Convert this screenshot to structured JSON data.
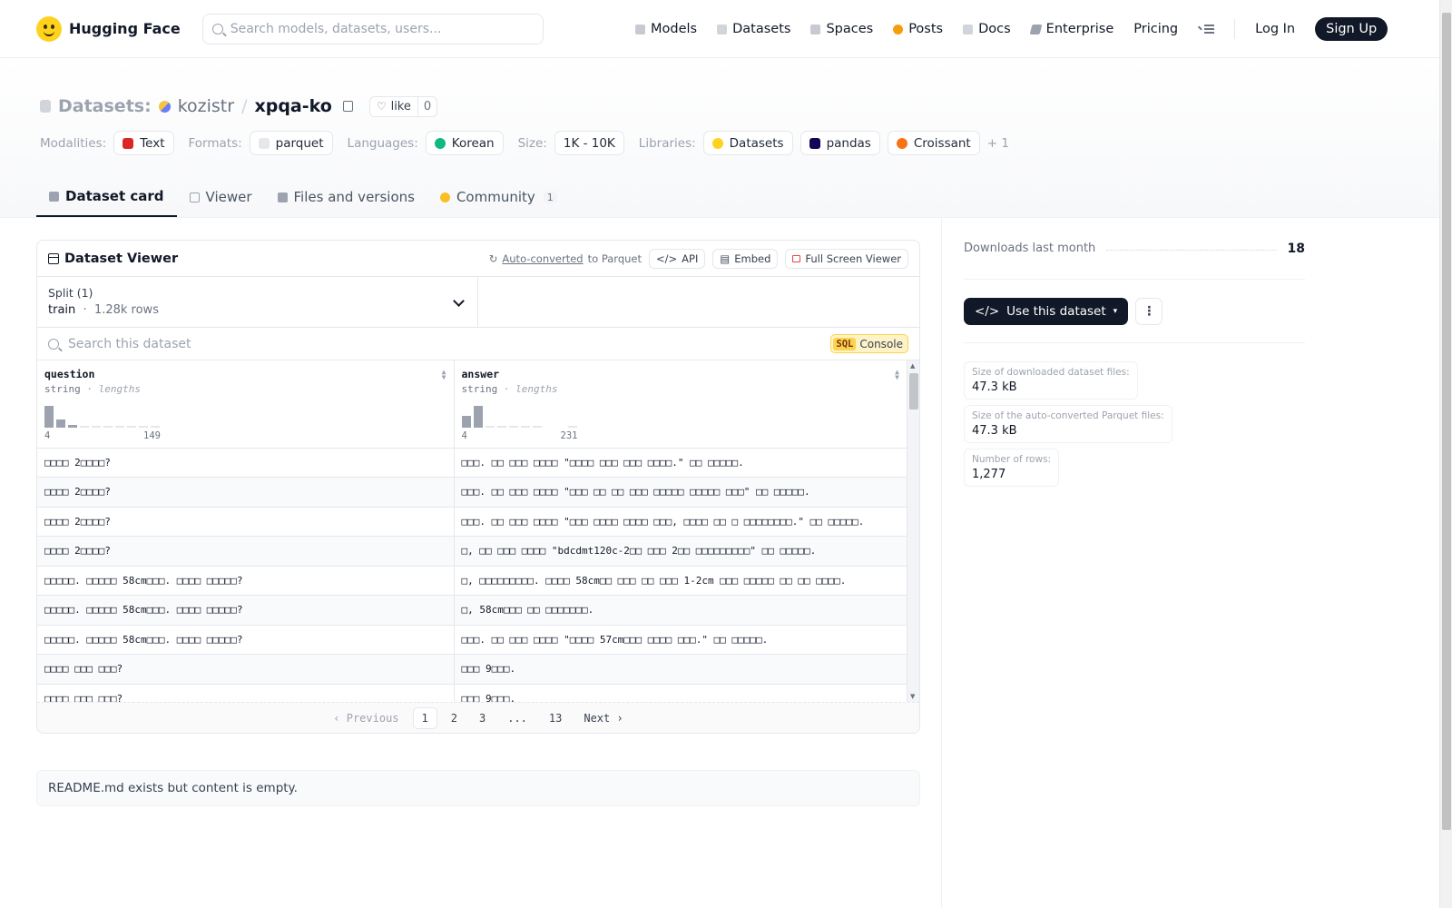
{
  "nav": {
    "brand": "Hugging Face",
    "search_placeholder": "Search models, datasets, users...",
    "links": [
      "Models",
      "Datasets",
      "Spaces",
      "Posts",
      "Docs",
      "Enterprise",
      "Pricing"
    ],
    "login": "Log In",
    "signup": "Sign Up"
  },
  "header": {
    "crumb_label": "Datasets:",
    "owner": "kozistr",
    "slash": "/",
    "name": "xpqa-ko",
    "like_label": "like",
    "like_count": "0",
    "tags": {
      "modalities_label": "Modalities:",
      "modalities": "Text",
      "formats_label": "Formats:",
      "formats": "parquet",
      "languages_label": "Languages:",
      "languages": "Korean",
      "size_label": "Size:",
      "size": "1K - 10K",
      "libraries_label": "Libraries:",
      "libraries": [
        "Datasets",
        "pandas",
        "Croissant"
      ],
      "more": "+ 1"
    },
    "tabs": [
      {
        "label": "Dataset card"
      },
      {
        "label": "Viewer"
      },
      {
        "label": "Files and versions"
      },
      {
        "label": "Community",
        "badge": "1"
      }
    ]
  },
  "viewer": {
    "title": "Dataset Viewer",
    "auto_converted": "Auto-converted",
    "to_parquet": "to Parquet",
    "api": "API",
    "embed": "Embed",
    "fullscreen": "Full Screen Viewer",
    "split_label": "Split (1)",
    "split_value": "train",
    "split_sep": "·",
    "split_rows": "1.28k rows",
    "search_placeholder": "Search this dataset",
    "sql": "SQL",
    "console": "Console",
    "columns": [
      {
        "name": "question",
        "type": "string",
        "lengths": "· lengths",
        "min": "4",
        "max": "149"
      },
      {
        "name": "answer",
        "type": "string",
        "lengths": "· lengths",
        "min": "4",
        "max": "231"
      }
    ],
    "rows": [
      [
        "□□□□ 2□□□□?",
        "□□□. □□ □□□ □□□□ \"□□□□ □□□ □□□ □□□□.\" □□ □□□□□."
      ],
      [
        "□□□□ 2□□□□?",
        "□□□. □□ □□□ □□□□ \"□□□ □□ □□ □□□ □□□□□ □□□□□ □□□\" □□ □□□□□."
      ],
      [
        "□□□□ 2□□□□?",
        "□□□. □□ □□□ □□□□ \"□□□ □□□□ □□□□ □□□, □□□□ □□ □ □□□□□□□□.\" □□ □□□□□."
      ],
      [
        "□□□□ 2□□□□?",
        "□, □□ □□□ □□□□ \"bdcdmt120c-2□□ □□□ 2□□ □□□□□□□□□\" □□ □□□□□."
      ],
      [
        "□□□□□. □□□□□ 58cm□□□. □□□□ □□□□□?",
        "□, □□□□□□□□□. □□□□ 58cm□□ □□□ □□ □□□ 1-2cm □□□ □□□□□ □□ □□ □□□□."
      ],
      [
        "□□□□□. □□□□□ 58cm□□□. □□□□ □□□□□?",
        "□, 58cm□□□ □□ □□□□□□□."
      ],
      [
        "□□□□□. □□□□□ 58cm□□□. □□□□ □□□□□?",
        "□□□. □□ □□□ □□□□ \"□□□□ 57cm□□□ □□□□ □□□.\" □□ □□□□□."
      ],
      [
        "□□□□ □□□ □□□?",
        "□□□ 9□□□."
      ],
      [
        "□□□□ □□□ □□□?",
        "□□□ 9□□□."
      ]
    ],
    "pager": {
      "prev": "Previous",
      "pages": [
        "1",
        "2",
        "3",
        "...",
        "13"
      ],
      "next": "Next"
    }
  },
  "readme_text": "README.md exists but content is empty.",
  "sidebar": {
    "downloads_label": "Downloads last month",
    "downloads_value": "18",
    "use_button": "Use this dataset",
    "stats": [
      {
        "label": "Size of downloaded dataset files:",
        "value": "47.3 kB"
      },
      {
        "label": "Size of the auto-converted Parquet files:",
        "value": "47.3 kB"
      },
      {
        "label": "Number of rows:",
        "value": "1,277"
      }
    ]
  },
  "colors": {
    "accent_dark": "#111827",
    "brand_yellow": "#ffd21e",
    "sql_yellow": "#fcd34d"
  }
}
